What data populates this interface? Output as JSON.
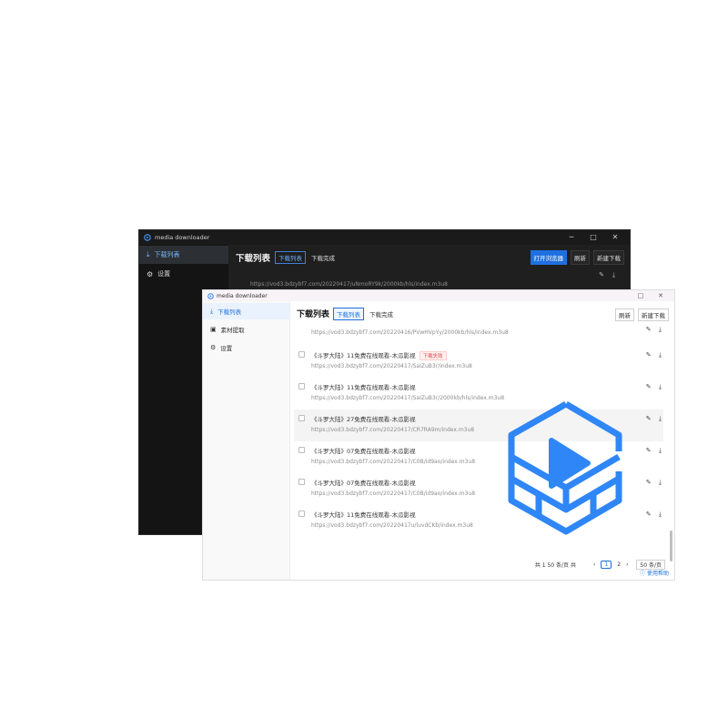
{
  "dark_window": {
    "title": "media downloader",
    "controls": [
      "─",
      "□",
      "✕"
    ],
    "sidebar": [
      {
        "icon": "⤓",
        "label": "下载列表",
        "active": true
      },
      {
        "icon": "⚙",
        "label": "设置",
        "active": false
      }
    ],
    "header": {
      "title": "下载列表",
      "tabs": [
        "下载列表",
        "下载完成"
      ],
      "actions": [
        "打开浏览器",
        "刷新",
        "新建下载"
      ]
    },
    "row": {
      "url": "https://vod3.bdzybf7.com/20220417/uNmoRY9k/2000kb/hls/index.m3u8"
    }
  },
  "light_window": {
    "title": "media downloader",
    "controls": [
      "□",
      "✕"
    ],
    "sidebar": [
      {
        "icon": "⤓",
        "label": "下载列表",
        "active": true
      },
      {
        "icon": "▣",
        "label": "素材提取",
        "active": false
      },
      {
        "icon": "⚙",
        "label": "设置",
        "active": false
      }
    ],
    "header": {
      "title": "下载列表",
      "tabs": [
        "下载列表",
        "下载完成"
      ],
      "actions": [
        "刷新",
        "新建下载"
      ]
    },
    "partial_row_url": "https://vod3.bdzybf7.com/20220416/PVwHVpYy/2000kb/hls/index.m3u8",
    "rows": [
      {
        "name": "《斗罗大陆》11免费在线观看-木瓜影视",
        "status": "下载失败",
        "url": "https://vod3.bdzybf7.com/20220417/SaIZuB3r/index.m3u8"
      },
      {
        "name": "《斗罗大陆》11免费在线观看-木瓜影视",
        "status": "",
        "url": "https://vod3.bdzybf7.com/20220417/SaIZuB3r/2000kb/hls/index.m3u8"
      },
      {
        "name": "《斗罗大陆》27免费在线观看-木瓜影视",
        "status": "",
        "url": "https://vod3.bdzybf7.com/20220417/CR7RA9m/index.m3u8"
      },
      {
        "name": "《斗罗大陆》07免费在线观看-木瓜影视",
        "status": "",
        "url": "https://vod3.bdzybf7.com/20220417/C0B/id9ao/index.m3u8"
      },
      {
        "name": "《斗罗大陆》07免费在线观看-木瓜影视",
        "status": "",
        "url": "https://vod3.bdzybf7.com/20220417/C0B/id9ao/index.m3u8"
      },
      {
        "name": "《斗罗大陆》11免费在线观看-木瓜影视",
        "status": "",
        "url": "https://vod3.bdzybf7.com/20220417u/luvdCKb/index.m3u8"
      }
    ],
    "pager": {
      "total": "共 1 50 条/页 共",
      "pages": [
        "‹",
        "1",
        "2",
        "›"
      ],
      "current": "1",
      "size": "50 条/页"
    },
    "help": "使用帮助"
  },
  "icons": {
    "edit": "✎",
    "download": "⤓",
    "help": "?"
  },
  "colors": {
    "accent": "#1e6fd9",
    "logo_blue": "#2f86f6",
    "error": "#e4484f"
  }
}
